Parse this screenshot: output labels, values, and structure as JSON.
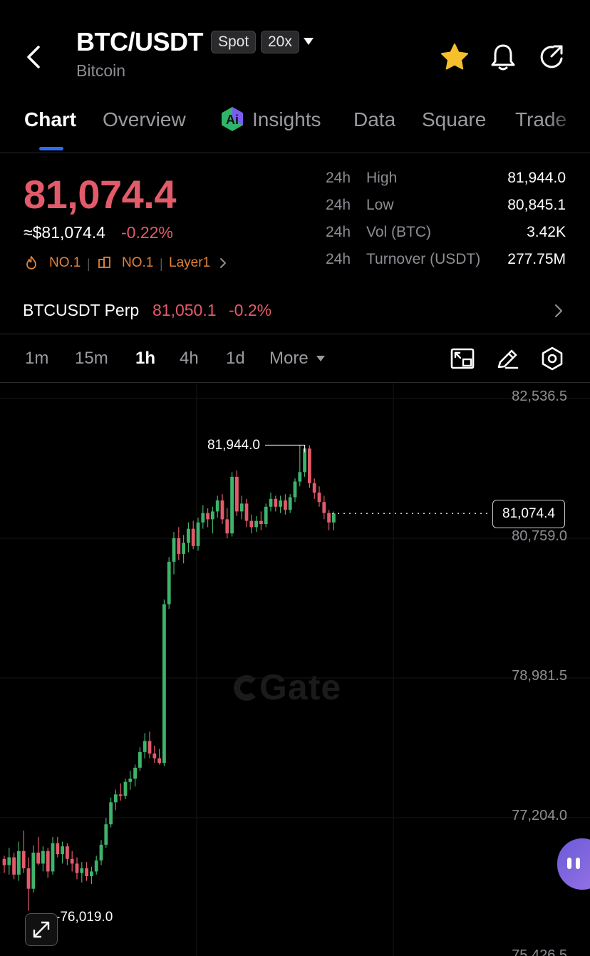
{
  "header": {
    "pair": "BTC/USDT",
    "badge_type": "Spot",
    "badge_leverage": "20x",
    "subtitle": "Bitcoin",
    "favorite_color": "#f5c02c"
  },
  "tabs": [
    "Chart",
    "Overview",
    "Insights",
    "Data",
    "Square",
    "Trade"
  ],
  "active_tab": "Chart",
  "price": {
    "last": "81,074.4",
    "fiat": "≈$81,074.4",
    "change": "-0.22%",
    "rank1": "NO.1",
    "rank2": "NO.1",
    "category": "Layer1",
    "down_color": "#e25b6a",
    "up_color": "#3eb36b"
  },
  "stats": [
    {
      "period": "24h",
      "label": "High",
      "value": "81,944.0"
    },
    {
      "period": "24h",
      "label": "Low",
      "value": "80,845.1"
    },
    {
      "period": "24h",
      "label": "Vol (BTC)",
      "value": "3.42K"
    },
    {
      "period": "24h",
      "label": "Turnover (USDT)",
      "value": "277.75M"
    }
  ],
  "perp": {
    "label": "BTCUSDT Perp",
    "price": "81,050.1",
    "change": "-0.2%"
  },
  "intervals": [
    "1m",
    "15m",
    "1h",
    "4h",
    "1d",
    "More"
  ],
  "active_interval": "1h",
  "chart": {
    "watermark": "Gate",
    "current_price": "81,074.4",
    "high_marker": "81,944.0",
    "low_marker": "76,019.0",
    "y_ticks": [
      "82,536.5",
      "80,759.0",
      "78,981.5",
      "77,204.0",
      "75,426.5"
    ]
  },
  "chart_data": {
    "type": "candlestick",
    "interval": "1h",
    "y_axis_ticks": [
      82536.5,
      80759.0,
      78981.5,
      77204.0,
      75426.5
    ],
    "current_price": 81074.4,
    "high": 81944.0,
    "low": 76019.0,
    "candles_ohlc": [
      [
        76680,
        76720,
        76500,
        76600
      ],
      [
        76600,
        76820,
        76480,
        76700
      ],
      [
        76700,
        76760,
        76420,
        76480
      ],
      [
        76480,
        76900,
        76400,
        76780
      ],
      [
        76780,
        77040,
        76500,
        76560
      ],
      [
        76560,
        76700,
        76020,
        76300
      ],
      [
        76300,
        76850,
        76250,
        76760
      ],
      [
        76760,
        76960,
        76600,
        76620
      ],
      [
        76620,
        76840,
        76520,
        76780
      ],
      [
        76780,
        76820,
        76440,
        76520
      ],
      [
        76520,
        76960,
        76480,
        76880
      ],
      [
        76880,
        76960,
        76700,
        76740
      ],
      [
        76740,
        76900,
        76620,
        76840
      ],
      [
        76840,
        76880,
        76600,
        76680
      ],
      [
        76680,
        76780,
        76520,
        76620
      ],
      [
        76620,
        76700,
        76420,
        76500
      ],
      [
        76500,
        76640,
        76380,
        76560
      ],
      [
        76560,
        76640,
        76400,
        76460
      ],
      [
        76460,
        76580,
        76360,
        76520
      ],
      [
        76520,
        76720,
        76480,
        76660
      ],
      [
        76660,
        76920,
        76600,
        76860
      ],
      [
        76860,
        77200,
        76820,
        77120
      ],
      [
        77120,
        77460,
        77080,
        77400
      ],
      [
        77400,
        77560,
        77300,
        77500
      ],
      [
        77500,
        77640,
        77420,
        77480
      ],
      [
        77480,
        77700,
        77440,
        77660
      ],
      [
        77660,
        77800,
        77560,
        77700
      ],
      [
        77700,
        77880,
        77600,
        77840
      ],
      [
        77840,
        78100,
        77800,
        78040
      ],
      [
        78040,
        78280,
        77960,
        78180
      ],
      [
        78180,
        78300,
        77960,
        78020
      ],
      [
        78020,
        78120,
        77900,
        77960
      ],
      [
        77960,
        78080,
        77880,
        77900
      ],
      [
        77900,
        79980,
        77860,
        79920
      ],
      [
        79920,
        80520,
        79860,
        80460
      ],
      [
        80460,
        80840,
        80300,
        80760
      ],
      [
        80760,
        80900,
        80480,
        80560
      ],
      [
        80560,
        80800,
        80440,
        80700
      ],
      [
        80700,
        80960,
        80580,
        80880
      ],
      [
        80880,
        80980,
        80620,
        80660
      ],
      [
        80660,
        81020,
        80600,
        80960
      ],
      [
        80960,
        81180,
        80880,
        81080
      ],
      [
        81080,
        81140,
        80900,
        81000
      ],
      [
        81000,
        81160,
        80820,
        81100
      ],
      [
        81100,
        81300,
        81020,
        81240
      ],
      [
        81240,
        81320,
        80940,
        81000
      ],
      [
        81000,
        81140,
        80760,
        80820
      ],
      [
        80820,
        81600,
        80780,
        81540
      ],
      [
        81540,
        81620,
        81040,
        81100
      ],
      [
        81100,
        81300,
        81000,
        81200
      ],
      [
        81200,
        81260,
        80900,
        80980
      ],
      [
        80980,
        81060,
        80820,
        80900
      ],
      [
        80900,
        81040,
        80840,
        80980
      ],
      [
        80980,
        81100,
        80860,
        80940
      ],
      [
        80940,
        81200,
        80900,
        81160
      ],
      [
        81160,
        81340,
        81100,
        81260
      ],
      [
        81260,
        81300,
        81100,
        81160
      ],
      [
        81160,
        81300,
        81080,
        81240
      ],
      [
        81240,
        81320,
        81060,
        81120
      ],
      [
        81120,
        81320,
        81080,
        81280
      ],
      [
        81280,
        81520,
        81220,
        81480
      ],
      [
        81480,
        81940,
        81420,
        81600
      ],
      [
        81600,
        81944,
        81540,
        81900
      ],
      [
        81900,
        81940,
        81400,
        81460
      ],
      [
        81460,
        81520,
        81260,
        81340
      ],
      [
        81340,
        81420,
        81160,
        81220
      ],
      [
        81220,
        81300,
        81000,
        81080
      ],
      [
        81080,
        81120,
        80860,
        80960
      ],
      [
        80960,
        81100,
        80860,
        81074.4
      ]
    ]
  }
}
